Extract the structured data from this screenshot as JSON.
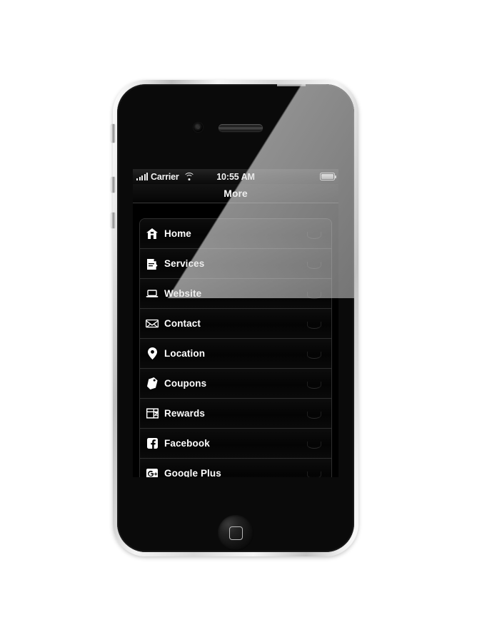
{
  "device": {
    "name": "iPhone mockup",
    "hardware": {
      "front_camera": "front-camera",
      "earpiece": "earpiece-speaker",
      "mute_switch": "mute-switch",
      "volume_up": "volume-up-button",
      "volume_down": "volume-down-button",
      "power": "power-button",
      "home_button": "home-button"
    }
  },
  "status_bar": {
    "signal_icon": "signal-bars-icon",
    "carrier": "Carrier",
    "wifi_icon": "wifi-icon",
    "time": "10:55 AM",
    "battery_icon": "battery-icon"
  },
  "nav_bar": {
    "title": "More"
  },
  "more_list": {
    "items": [
      {
        "label": "Home",
        "icon": "house-icon"
      },
      {
        "label": "Services",
        "icon": "document-check-icon"
      },
      {
        "label": "Website",
        "icon": "laptop-icon"
      },
      {
        "label": "Contact",
        "icon": "envelope-icon"
      },
      {
        "label": "Location",
        "icon": "map-pin-icon"
      },
      {
        "label": "Coupons",
        "icon": "tag-icon"
      },
      {
        "label": "Rewards",
        "icon": "gift-card-icon"
      },
      {
        "label": "Facebook",
        "icon": "facebook-icon"
      },
      {
        "label": "Google Plus",
        "icon": "google-plus-icon"
      }
    ],
    "accessory_icon": "arc-indicator-icon"
  },
  "colors": {
    "background": "#ffffff",
    "screen_background": "#000000",
    "text": "#ffffff",
    "separator": "#2e2e2e",
    "status_bar": "#161616"
  }
}
